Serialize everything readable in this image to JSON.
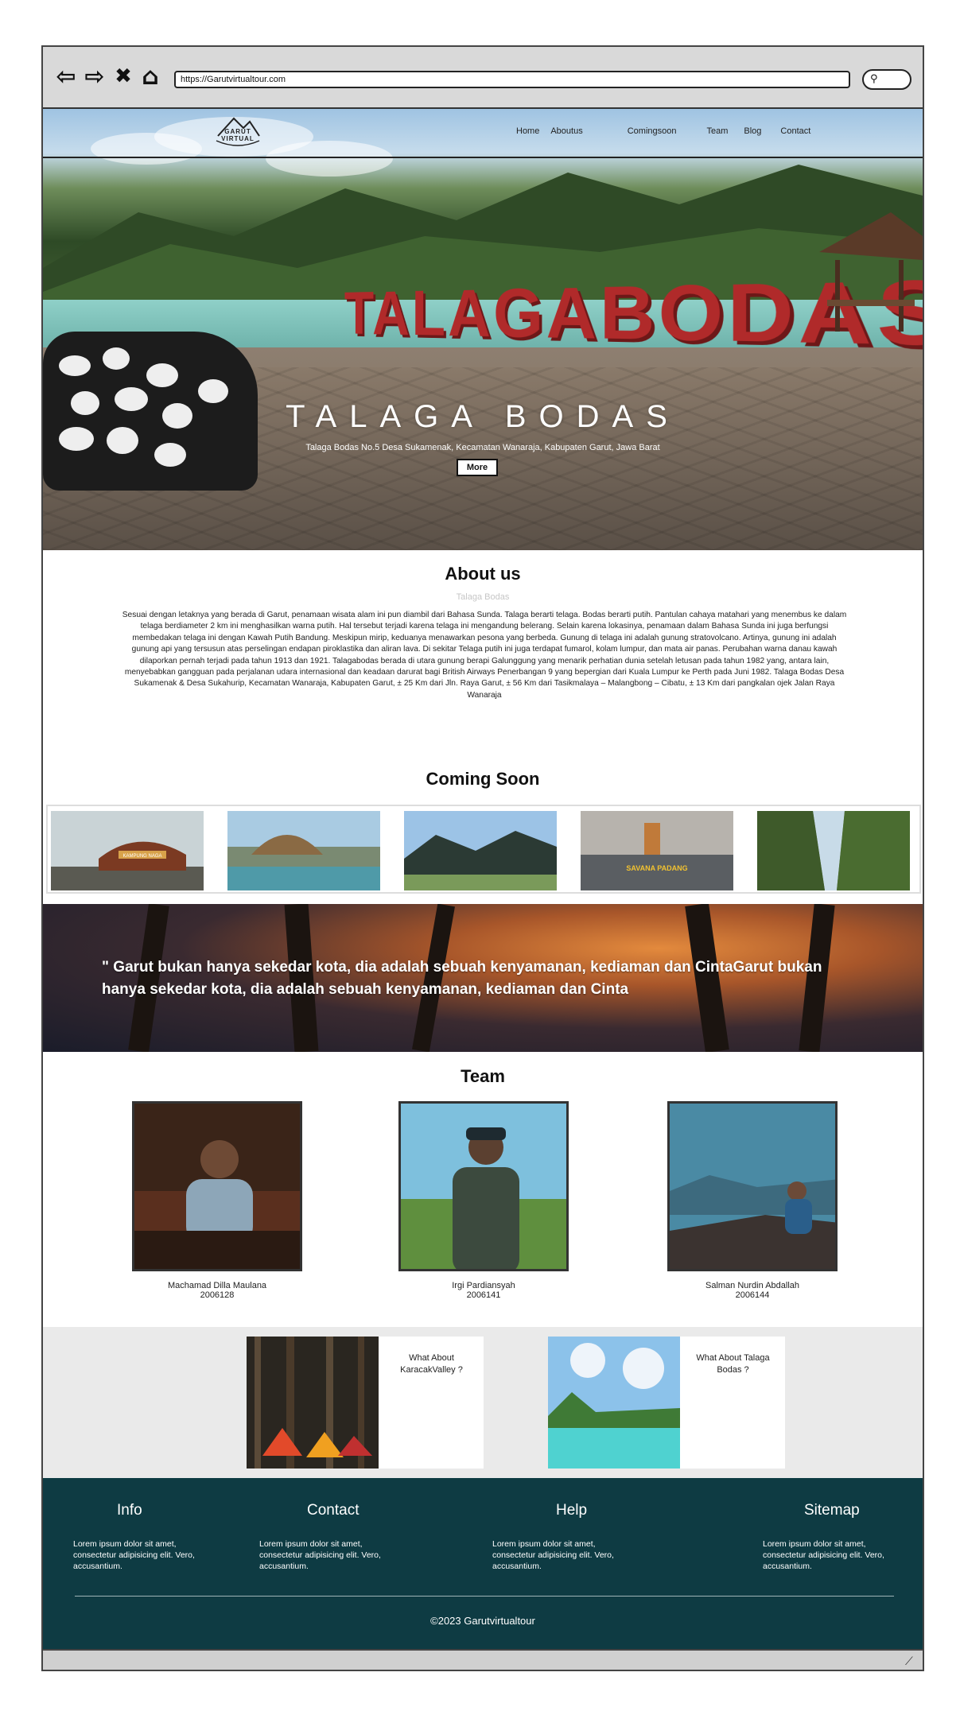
{
  "browser": {
    "url": "https://Garutvirtualtour.com",
    "icons": [
      "back-arrow-icon",
      "forward-arrow-icon",
      "close-x-icon",
      "home-icon",
      "search-icon"
    ]
  },
  "header": {
    "logo_text": "GARUT VIRTUAL",
    "menu": [
      "Home",
      "Aboutus",
      "Comingsoon",
      "Team",
      "Blog",
      "Contact"
    ]
  },
  "hero": {
    "sign_letters": "TALAGABODAS",
    "title": "TALAGA BODAS",
    "subtitle": "Talaga Bodas No.5 Desa Sukamenak, Kecamatan Wanaraja, Kabupaten Garut, Jawa Barat",
    "button_label": "More"
  },
  "about": {
    "heading": "About us",
    "subheading": "Talaga Bodas",
    "body": "Sesuai dengan letaknya yang berada di Garut, penamaan wisata alam ini pun diambil dari Bahasa Sunda. Talaga berarti telaga. Bodas berarti putih. Pantulan cahaya matahari yang menembus ke dalam telaga berdiameter 2 km ini menghasilkan warna putih. Hal tersebut terjadi karena telaga ini mengandung belerang. Selain karena lokasinya, penamaan dalam Bahasa Sunda ini juga berfungsi membedakan telaga ini dengan Kawah Putih Bandung. Meskipun mirip, keduanya menawarkan pesona yang berbeda. Gunung di telaga ini adalah gunung stratovolcano. Artinya, gunung ini adalah gunung api yang tersusun atas perselingan endapan piroklastika dan aliran lava. Di sekitar Telaga putih ini juga terdapat fumarol, kolam lumpur, dan mata air panas. Perubahan warna danau kawah dilaporkan pernah terjadi pada tahun 1913 dan 1921. Talagabodas berada di utara gunung berapi Galunggung yang menarik perhatian dunia setelah letusan pada tahun 1982 yang, antara lain, menyebabkan gangguan pada perjalanan udara internasional dan keadaan darurat bagi British Airways Penerbangan 9 yang bepergian dari Kuala Lumpur ke Perth pada Juni 1982. Talaga Bodas Desa Sukamenak & Desa Sukahurip, Kecamatan Wanaraja, Kabupaten Garut, ± 25 Km dari Jln. Raya Garut, ± 56 Km dari Tasikmalaya – Malangbong – Cibatu, ± 13 Km dari pangkalan ojek Jalan Raya Wanaraja"
  },
  "coming_soon": {
    "heading": "Coming Soon",
    "thumb_sign_text": "SAVANA PADANG",
    "thumb_arch_text": "KAMPUNG NAGA"
  },
  "quote": {
    "text": "\" Garut bukan hanya sekedar kota, dia adalah sebuah kenyamanan, kediaman dan CintaGarut bukan hanya sekedar kota, dia adalah sebuah kenyamanan, kediaman dan Cinta"
  },
  "team": {
    "heading": "Team",
    "members": [
      {
        "name": "Machamad Dilla Maulana",
        "nim": "2006128"
      },
      {
        "name": "Irgi Pardiansyah",
        "nim": "2006141"
      },
      {
        "name": "Salman Nurdin Abdallah",
        "nim": "2006144"
      }
    ]
  },
  "features": [
    {
      "caption": "What About KaracakValley ?"
    },
    {
      "caption": "What About Talaga Bodas ?"
    }
  ],
  "footer": {
    "columns": [
      {
        "heading": "Info",
        "text": "Lorem ipsum dolor sit amet, consectetur adipisicing elit. Vero, accusantium."
      },
      {
        "heading": "Contact",
        "text": "Lorem ipsum dolor sit amet, consectetur adipisicing elit. Vero, accusantium."
      },
      {
        "heading": "Help",
        "text": "Lorem ipsum dolor sit amet, consectetur adipisicing elit. Vero, accusantium."
      },
      {
        "heading": "Sitemap",
        "text": "Lorem ipsum dolor sit amet, consectetur adipisicing elit. Vero, accusantium."
      }
    ],
    "copyright": "©2023 Garutvirtualtour"
  },
  "colors": {
    "footer_bg": "#0e3b43",
    "features_bg": "#eaeaea",
    "chrome_bg": "#d9d9d9",
    "sign_red": "#b02a2a"
  }
}
